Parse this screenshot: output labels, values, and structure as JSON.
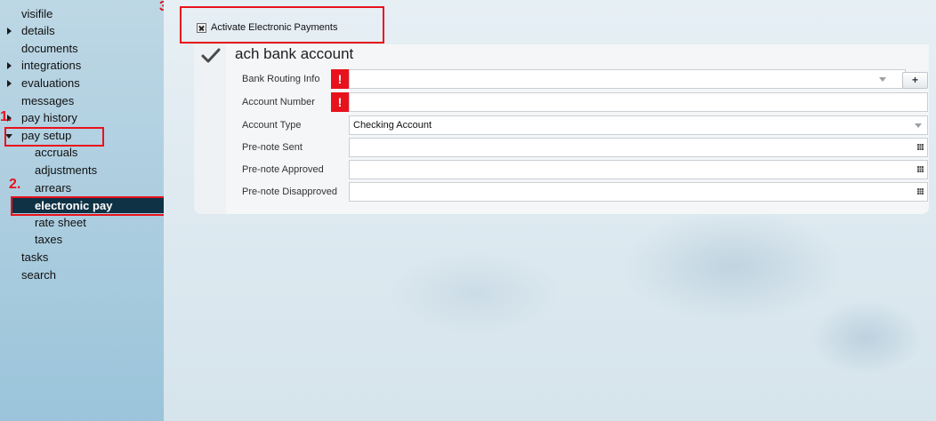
{
  "sidebar": {
    "items": [
      {
        "label": "visifile"
      },
      {
        "label": "details"
      },
      {
        "label": "documents"
      },
      {
        "label": "integrations"
      },
      {
        "label": "evaluations"
      },
      {
        "label": "messages"
      },
      {
        "label": "pay history"
      },
      {
        "label": "pay setup"
      },
      {
        "label": "accruals"
      },
      {
        "label": "adjustments"
      },
      {
        "label": "arrears"
      },
      {
        "label": "electronic pay"
      },
      {
        "label": "rate sheet"
      },
      {
        "label": "taxes"
      },
      {
        "label": "tasks"
      },
      {
        "label": "search"
      }
    ],
    "selected": "electronic pay"
  },
  "annotations": {
    "step1": "1.",
    "step2": "2.",
    "step3": "3.",
    "color": "#e8121c"
  },
  "activate": {
    "label": "Activate Electronic Payments",
    "checked": true
  },
  "section": {
    "title": "ach bank account",
    "icon": "checkmark-icon"
  },
  "fields": {
    "bank_routing": {
      "label": "Bank Routing Info",
      "value": "",
      "required_mark": "!"
    },
    "add_button": {
      "label": "+"
    },
    "account_number": {
      "label": "Account Number",
      "value": "",
      "required_mark": "!"
    },
    "account_type": {
      "label": "Account Type",
      "value": "Checking Account"
    },
    "prenote_sent": {
      "label": "Pre-note Sent",
      "value": ""
    },
    "prenote_approved": {
      "label": "Pre-note Approved",
      "value": ""
    },
    "prenote_disapproved": {
      "label": "Pre-note Disapproved",
      "value": ""
    }
  },
  "colors": {
    "sidebar_selected_bg": "#0f3245",
    "error_red": "#e8121c"
  }
}
